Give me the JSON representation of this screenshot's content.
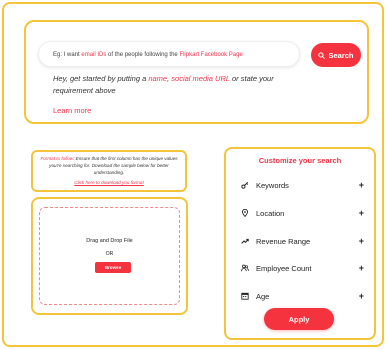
{
  "search": {
    "placeholder_prefix": "Eg: I want ",
    "placeholder_hl1": "email IDs",
    "placeholder_mid": " of the people following the ",
    "placeholder_hl2": "Flipkart Facebook Page",
    "button_label": "Search"
  },
  "hint": {
    "part1": "Hey, get started by putting a ",
    "hl_name": "name",
    "comma": ", ",
    "hl_social": "social media URL",
    "part2": " or state your requirement above"
  },
  "learn_more": "Learn more",
  "format_note": {
    "hl": "Format to follow:",
    "text": " Ensure that the first column has the unique values you're searching for. Download the sample below for better understanding.",
    "link": "Click here to download you format"
  },
  "upload": {
    "drop_text": "Drag and Drop File",
    "or_text": "OR",
    "browse_label": "Browse"
  },
  "customize": {
    "title": "Customize your search",
    "filters": [
      {
        "label": "Keywords",
        "icon": "key-icon"
      },
      {
        "label": "Location",
        "icon": "location-pin-icon"
      },
      {
        "label": "Revenue Range",
        "icon": "trend-up-icon"
      },
      {
        "label": "Employee Count",
        "icon": "users-icon"
      },
      {
        "label": "Age",
        "icon": "calendar-icon"
      }
    ],
    "plus": "+",
    "apply_label": "Apply"
  },
  "colors": {
    "accent": "#f5333f",
    "border": "#f5c43b",
    "highlight": "#f0334b"
  }
}
